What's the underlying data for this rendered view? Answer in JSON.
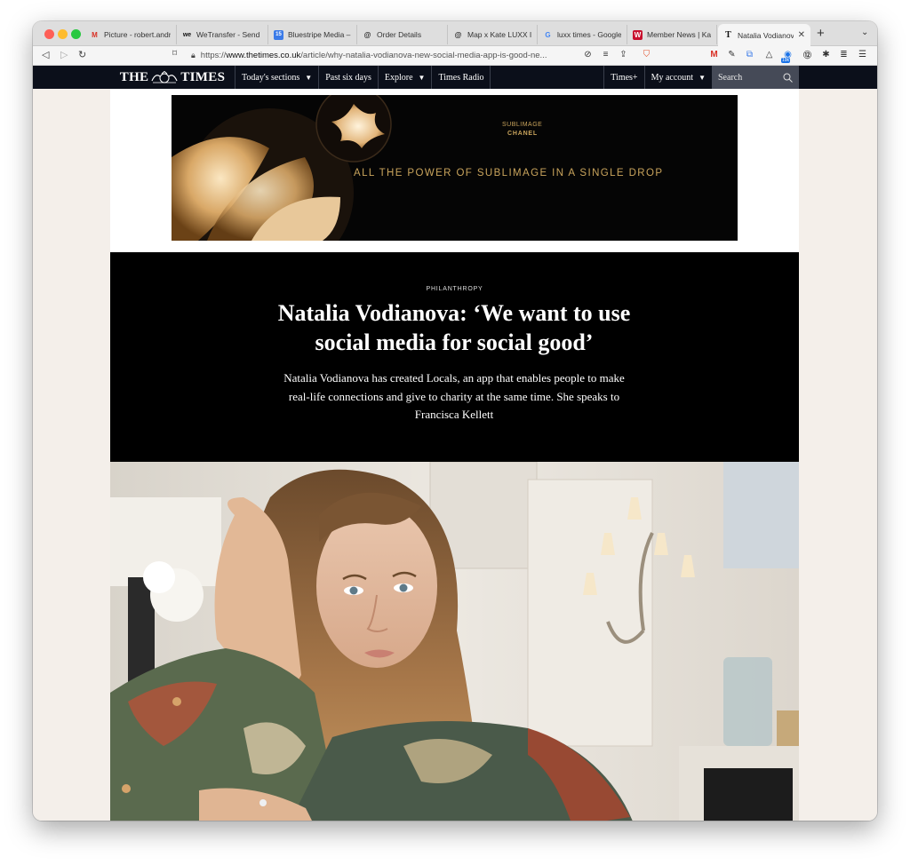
{
  "browser": {
    "tabs": [
      {
        "title": "Picture - robert.andr",
        "icon": "gmail-icon"
      },
      {
        "title": "WeTransfer - Send La",
        "icon": "wetransfer-icon"
      },
      {
        "title": "Bluestripe Media – C",
        "icon": "calendar-icon"
      },
      {
        "title": "Order Details",
        "icon": "at-icon"
      },
      {
        "title": "Map x Kate LUXX Inte",
        "icon": "at-icon"
      },
      {
        "title": "luxx times - Google S",
        "icon": "google-icon"
      },
      {
        "title": "Member News | Kate",
        "icon": "w-icon"
      },
      {
        "title": "Natalia Vodianova",
        "icon": "times-t-icon",
        "active": true
      }
    ],
    "url_prefix": "https://",
    "url_host": "www.thetimes.co.uk",
    "url_path": "/article/why-natalia-vodianova-new-social-media-app-is-good-ne...",
    "badge_count": "19k"
  },
  "site": {
    "logo_left": "THE",
    "logo_right": "TIMES",
    "nav": [
      {
        "label": "Today's sections",
        "dropdown": true
      },
      {
        "label": "Past six days",
        "dropdown": false
      },
      {
        "label": "Explore",
        "dropdown": true
      },
      {
        "label": "Times Radio",
        "dropdown": false
      }
    ],
    "times_plus": "Times+",
    "account": "My account",
    "search_placeholder": "Search"
  },
  "ad": {
    "brand_line1": "SUBLIMAGE",
    "brand_line2": "CHANEL",
    "tagline": "ALL THE POWER OF SUBLIMAGE IN A SINGLE DROP"
  },
  "article": {
    "kicker": "PHILANTHROPY",
    "headline": "Natalia Vodianova: ‘We want to use social media for social good’",
    "standfirst": "Natalia Vodianova has created Locals, an app that enables people to make real-life connections and give to charity at the same time. She speaks to Francisca Kellett"
  },
  "colors": {
    "nav_bg": "#0b0f1a",
    "search_bg": "#454a57",
    "page_bg": "#f4efea",
    "ad_gold": "#c9a45c"
  }
}
